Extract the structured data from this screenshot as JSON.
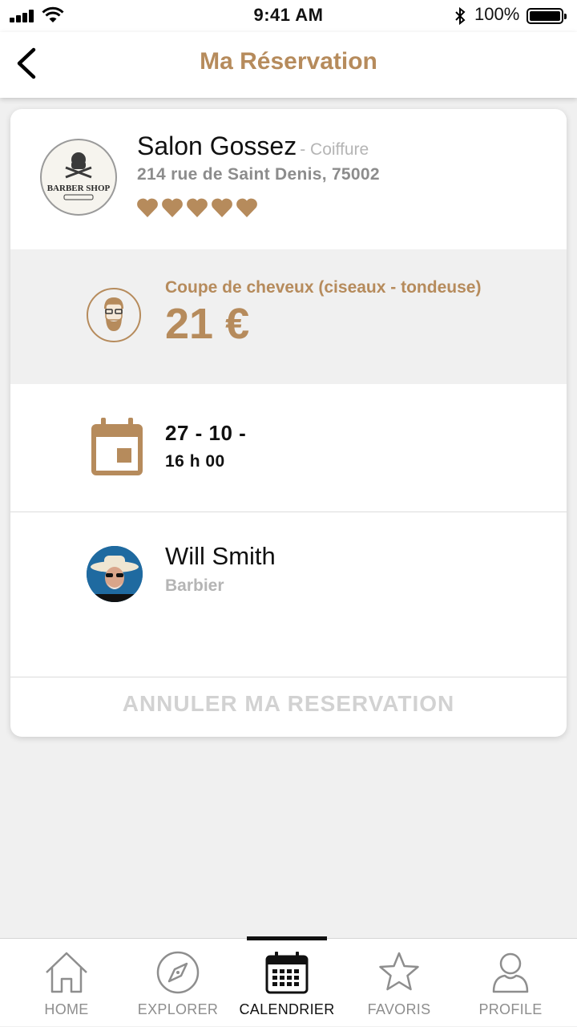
{
  "status_bar": {
    "time": "9:41 AM",
    "battery": "100%"
  },
  "header": {
    "title": "Ma Réservation"
  },
  "salon": {
    "logo_text": "BARBER SHOP",
    "name": "Salon Gossez",
    "category": "- Coiffure",
    "address": "214 rue de Saint Denis, 75002",
    "rating": 5
  },
  "service": {
    "name": "Coupe de cheveux (ciseaux - tondeuse)",
    "price": "21 €"
  },
  "appointment": {
    "date": "27 - 10 -",
    "time": "16 h 00"
  },
  "barber": {
    "name": "Will Smith",
    "role": "Barbier"
  },
  "cancel_label": "ANNULER MA RESERVATION",
  "tabs": [
    {
      "label": "HOME",
      "icon": "home-icon"
    },
    {
      "label": "EXPLORER",
      "icon": "compass-icon"
    },
    {
      "label": "CALENDRIER",
      "icon": "calendar-icon",
      "active": true
    },
    {
      "label": "FAVORIS",
      "icon": "star-icon"
    },
    {
      "label": "PROFILE",
      "icon": "person-icon"
    }
  ],
  "colors": {
    "accent": "#b68b5c",
    "background": "#f0f0f0",
    "muted": "#b5b5b5"
  }
}
